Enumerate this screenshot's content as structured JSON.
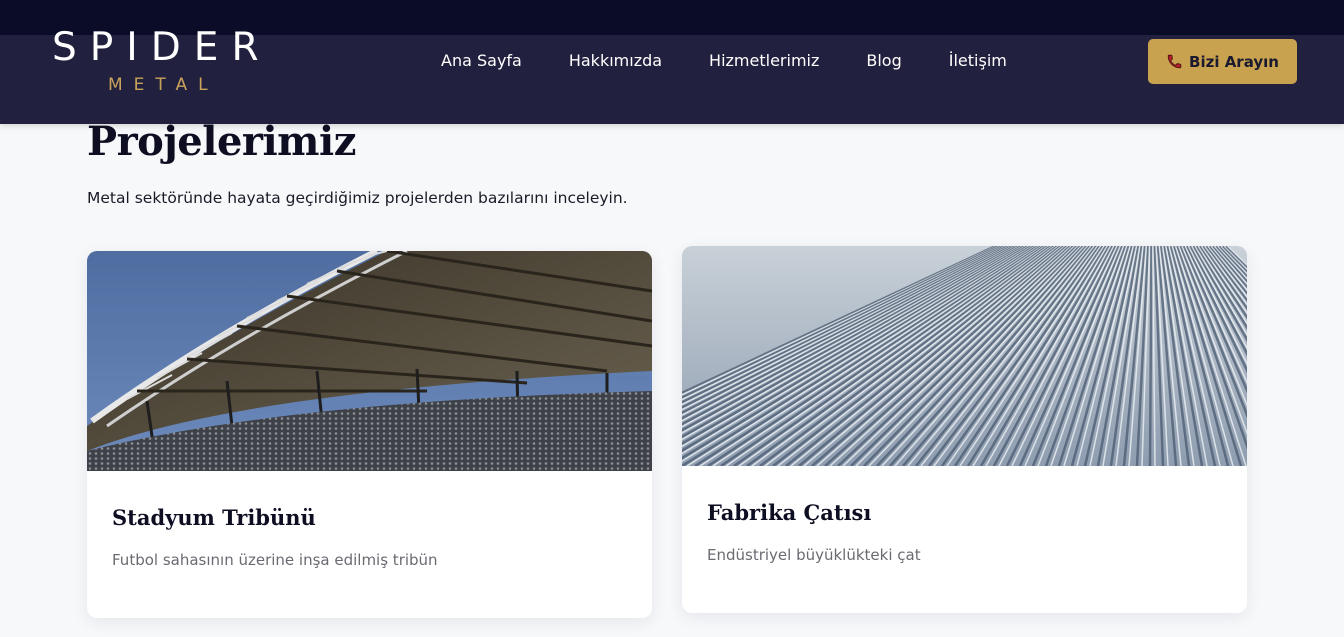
{
  "brand": {
    "name": "SPIDER",
    "tagline": "METAL"
  },
  "nav": {
    "items": [
      {
        "label": "Ana Sayfa"
      },
      {
        "label": "Hakkımızda"
      },
      {
        "label": "Hizmetlerimiz"
      },
      {
        "label": "Blog"
      },
      {
        "label": "İletişim"
      }
    ],
    "cta_label": "Bizi Arayın",
    "cta_icon": "phone-icon"
  },
  "section": {
    "title": "Projelerimiz",
    "subtitle": "Metal sektöründe hayata geçirdiğimiz projelerden bazılarını inceleyin."
  },
  "projects": [
    {
      "title": "Stadyum Tribünü",
      "description": "Futbol sahasının üzerine inşa edilmiş tribün"
    },
    {
      "title": "Fabrika Çatısı",
      "description": "Endüstriyel büyüklükteki çat"
    }
  ],
  "colors": {
    "header_bg": "#21213f",
    "top_strip": "#0b0c28",
    "accent_gold": "#c9a24f",
    "page_bg": "#f7f8fa"
  }
}
